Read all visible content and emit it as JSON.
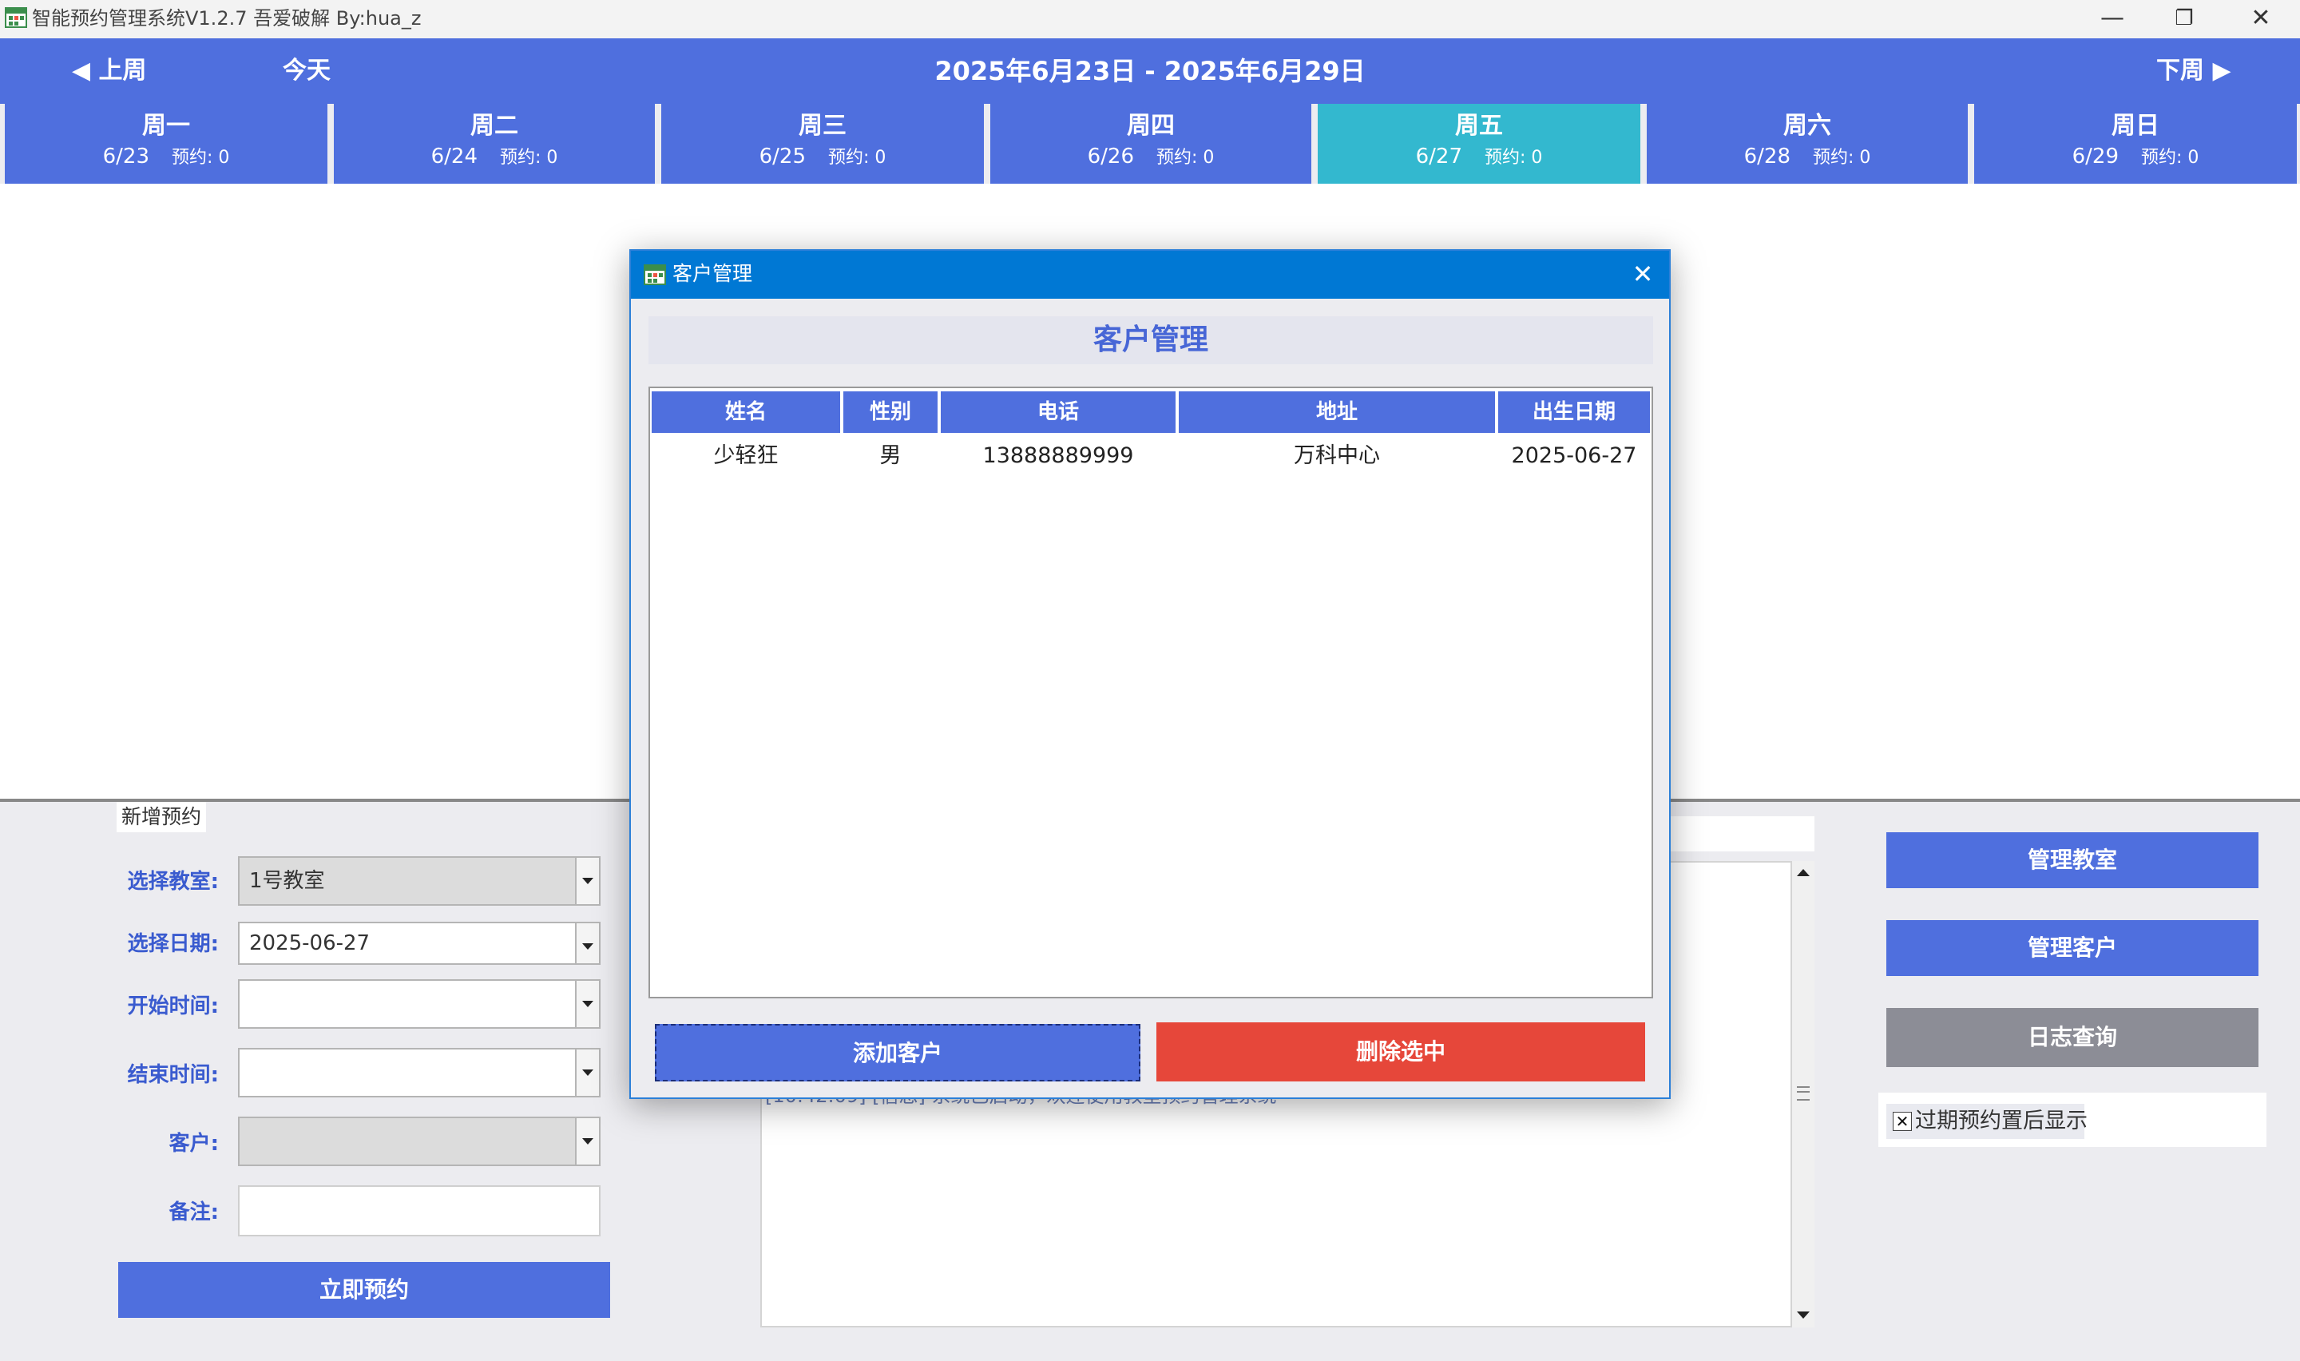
{
  "window": {
    "title": "智能预约管理系统V1.2.7 吾爱破解 By:hua_z",
    "minimize": "—",
    "restore": "❐",
    "close": "✕"
  },
  "calendar": {
    "prev_week": "◀ 上周",
    "today": "今天",
    "week_range": "2025年6月23日 - 2025年6月29日",
    "next_week": "下周 ▶",
    "days": [
      {
        "name": "周一",
        "date": "6/23",
        "count": "预约: 0"
      },
      {
        "name": "周二",
        "date": "6/24",
        "count": "预约: 0"
      },
      {
        "name": "周三",
        "date": "6/25",
        "count": "预约: 0"
      },
      {
        "name": "周四",
        "date": "6/26",
        "count": "预约: 0"
      },
      {
        "name": "周五",
        "date": "6/27",
        "count": "预约: 0"
      },
      {
        "name": "周六",
        "date": "6/28",
        "count": "预约: 0"
      },
      {
        "name": "周日",
        "date": "6/29",
        "count": "预约: 0"
      }
    ],
    "active_day_index": 4
  },
  "form": {
    "group_title": "新增预约",
    "classroom_label": "选择教室:",
    "classroom_value": "1号教室",
    "date_label": "选择日期:",
    "date_value": "2025-06-27",
    "start_label": "开始时间:",
    "start_value": "",
    "end_label": "结束时间:",
    "end_value": "",
    "customer_label": "客户:",
    "customer_value": "",
    "note_label": "备注:",
    "note_value": "",
    "submit": "立即预约"
  },
  "log": {
    "visible_line": "[10:42:09] [信息] 系统已启动，欢迎使用教室预约管理系统"
  },
  "side": {
    "manage_classrooms": "管理教室",
    "manage_customers": "管理客户",
    "log_query": "日志查询",
    "overdue_last": "过期预约置后显示",
    "overdue_checked": true
  },
  "dialog": {
    "title": "客户管理",
    "heading": "客户管理",
    "columns": [
      "姓名",
      "性别",
      "电话",
      "地址",
      "出生日期"
    ],
    "rows": [
      [
        "少轻狂",
        "男",
        "13888889999",
        "万科中心",
        "2025-06-27"
      ]
    ],
    "add_button": "添加客户",
    "delete_button": "删除选中"
  },
  "colors": {
    "primary": "#4f6fde",
    "active_day": "#33b8cf",
    "danger": "#e6473a",
    "disabled_button": "#8c8d96",
    "dialog_title": "#0078d4"
  }
}
